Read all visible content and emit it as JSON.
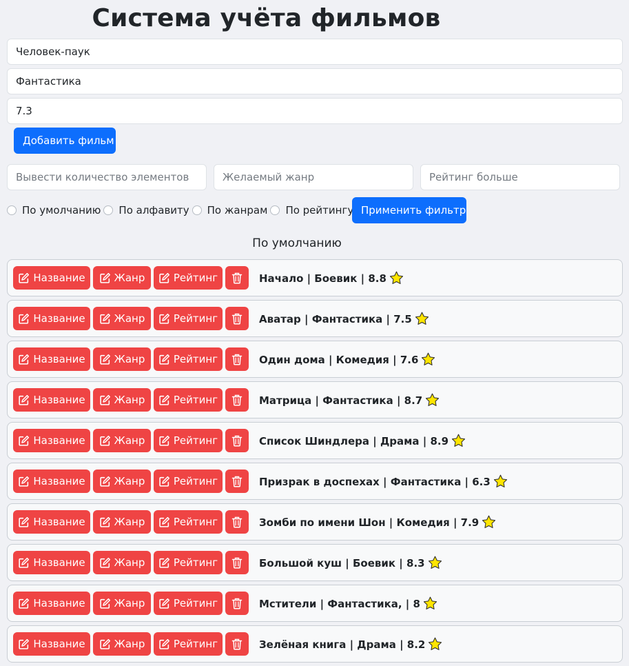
{
  "header": {
    "title": "Система учёта фильмов"
  },
  "add_form": {
    "title_value": "Человек-паук",
    "genre_value": "Фантастика",
    "rating_value": "7.3",
    "add_button": "Добавить фильм"
  },
  "filters": {
    "count_placeholder": "Вывести количество элементов",
    "genre_placeholder": "Желаемый жанр",
    "rating_placeholder": "Рейтинг больше",
    "apply_button": "Применить фильтр",
    "sort_options": [
      "По умолчанию",
      "По алфавиту",
      "По жанрам",
      "По рейтингу"
    ]
  },
  "current_sort": "По умолчанию",
  "row_buttons": {
    "name": "Название",
    "genre": "Жанр",
    "rating": "Рейтинг"
  },
  "icons": {
    "edit": "edit-icon",
    "delete": "trash-icon",
    "rating": "star-icon"
  },
  "colors": {
    "primary": "#0d6efd",
    "danger": "#ef4444",
    "star": "#ffe500"
  },
  "movies": [
    {
      "text": "Начало | Боевик | 8.8"
    },
    {
      "text": "Аватар | Фантастика | 7.5"
    },
    {
      "text": "Один дома | Комедия | 7.6"
    },
    {
      "text": "Матрица | Фантастика | 8.7"
    },
    {
      "text": "Список Шиндлера | Драма | 8.9"
    },
    {
      "text": "Призрак в доспехах | Фантастика | 6.3"
    },
    {
      "text": "Зомби по имени Шон | Комедия | 7.9"
    },
    {
      "text": "Большой куш | Боевик | 8.3"
    },
    {
      "text": "Мстители | Фантастика, | 8"
    },
    {
      "text": "Зелёная книга | Драма | 8.2"
    }
  ]
}
